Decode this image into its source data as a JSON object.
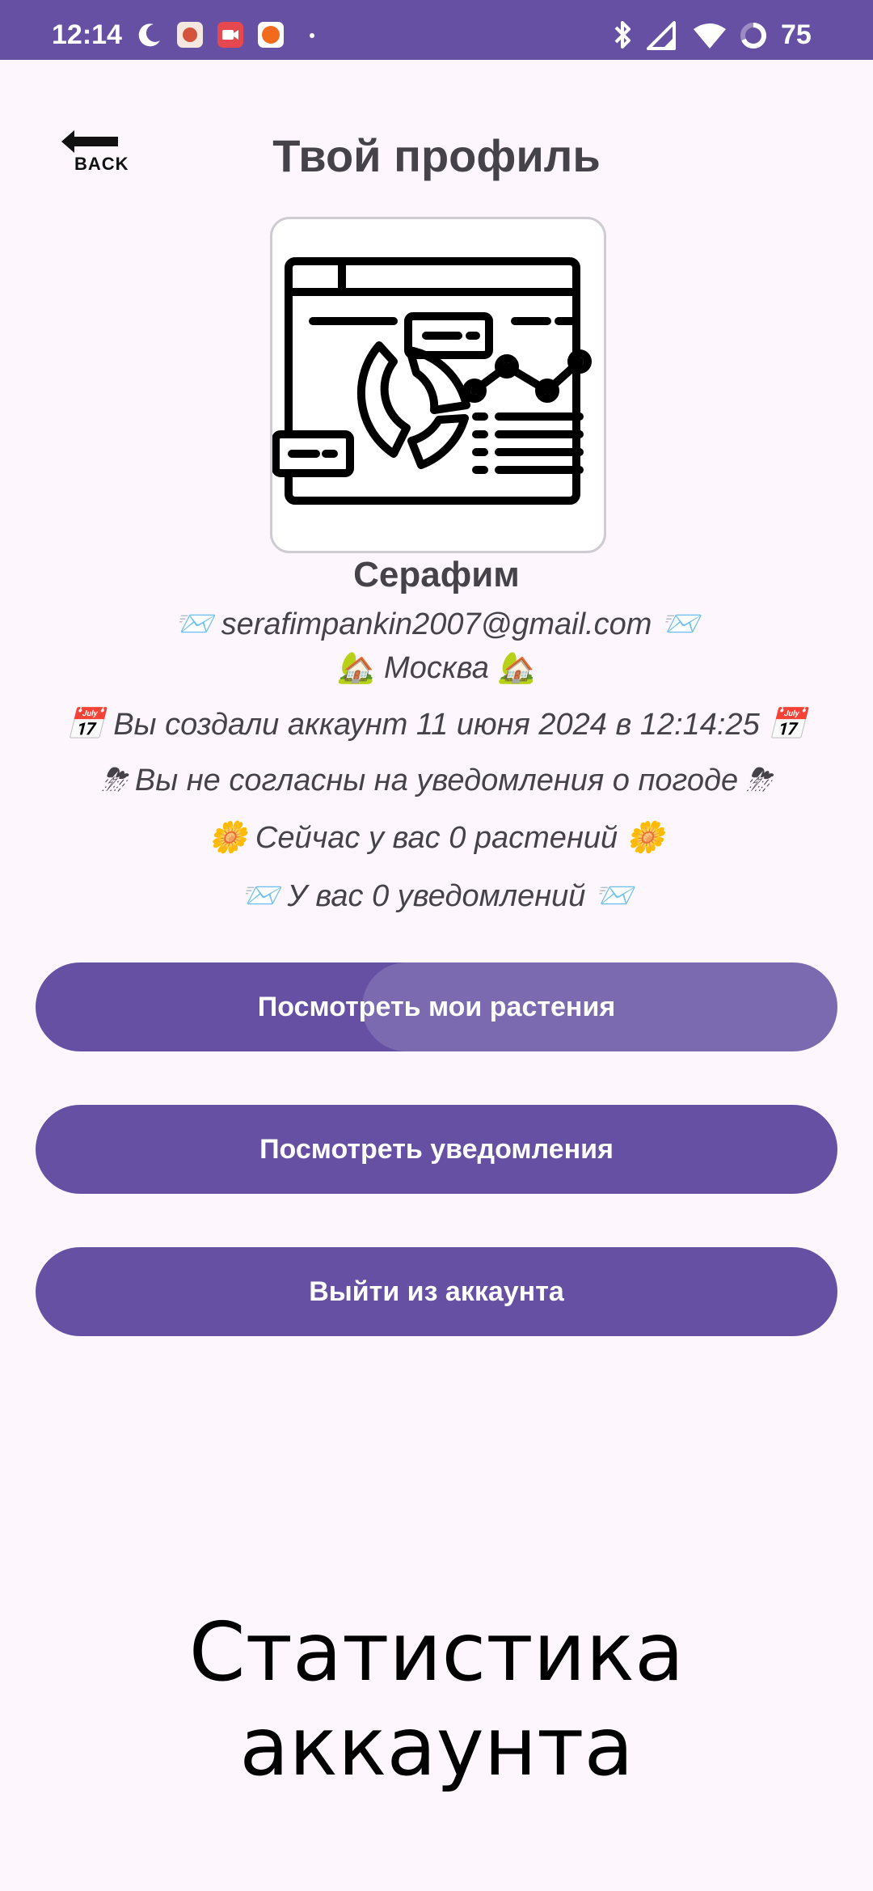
{
  "status_bar": {
    "time": "12:14",
    "battery": "75",
    "icons": [
      "moon-icon",
      "app-icon",
      "video-icon",
      "app-icon",
      "dot-icon",
      "bluetooth-icon",
      "signal-icon",
      "wifi-icon",
      "battery-ring-icon"
    ]
  },
  "header": {
    "back_label": "BACK",
    "title": "Твой профиль"
  },
  "profile": {
    "name": "Серафим",
    "email_line": "📨 serafimpankin2007@gmail.com 📨",
    "city_line": "🏡 Москва 🏡",
    "created_line": "📅 Вы создали аккаунт 11 июня 2024 в 12:14:25 📅",
    "weather_line": "⛈ Вы не согласны на уведомления о погоде ⛈",
    "plants_line": "🌼 Сейчас у вас 0 растений 🌼",
    "notifications_line": "📨 У вас 0 уведомлений 📨"
  },
  "buttons": {
    "plants": "Посмотреть мои растения",
    "notifications": "Посмотреть уведомления",
    "logout": "Выйти из аккаунта"
  },
  "stats": {
    "title": "Статистика аккаунта"
  },
  "colors": {
    "accent": "#6650a4",
    "background": "#fdf7fd",
    "text": "#45424a"
  }
}
